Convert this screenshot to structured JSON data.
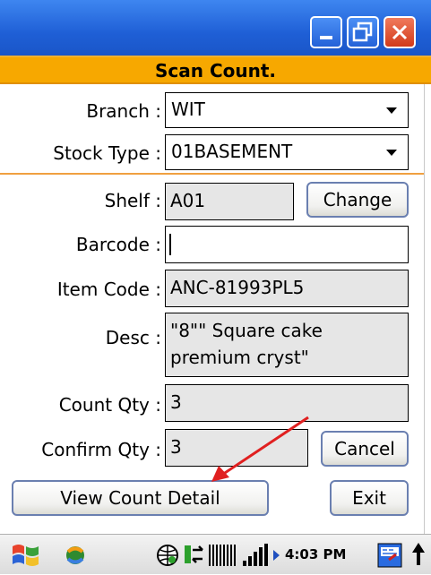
{
  "window": {
    "title": "",
    "buttons": [
      "minimize",
      "restore",
      "close"
    ]
  },
  "header": {
    "title": "Scan Count."
  },
  "form": {
    "branch_label": "Branch :",
    "branch_value": "WIT",
    "stock_type_label": "Stock Type :",
    "stock_type_value": "01BASEMENT",
    "shelf_label": "Shelf :",
    "shelf_value": "A01",
    "change_label": "Change",
    "barcode_label": "Barcode :",
    "barcode_value": "",
    "item_code_label": "Item Code :",
    "item_code_value": "ANC-81993PL5",
    "desc_label": "Desc :",
    "desc_line1": "\"8\"\" Square cake",
    "desc_line2": "premium cryst\"",
    "count_qty_label": "Count Qty :",
    "count_qty_value": "3",
    "confirm_qty_label": "Confirm Qty :",
    "confirm_qty_value": "3",
    "cancel_label": "Cancel",
    "view_detail_label": "View Count Detail",
    "exit_label": "Exit"
  },
  "taskbar": {
    "time": "4:03 PM",
    "icons": [
      "windows-start-icon",
      "sync-icon",
      "globe-icon",
      "connection-icon",
      "signal-bars-icon",
      "speaker-icon",
      "keyboard-icon",
      "up-arrow-icon"
    ]
  },
  "colors": {
    "titlebar": "#2a6be0",
    "header": "#f7a800",
    "divider": "#f0a040",
    "annotation_arrow": "#e02020"
  }
}
